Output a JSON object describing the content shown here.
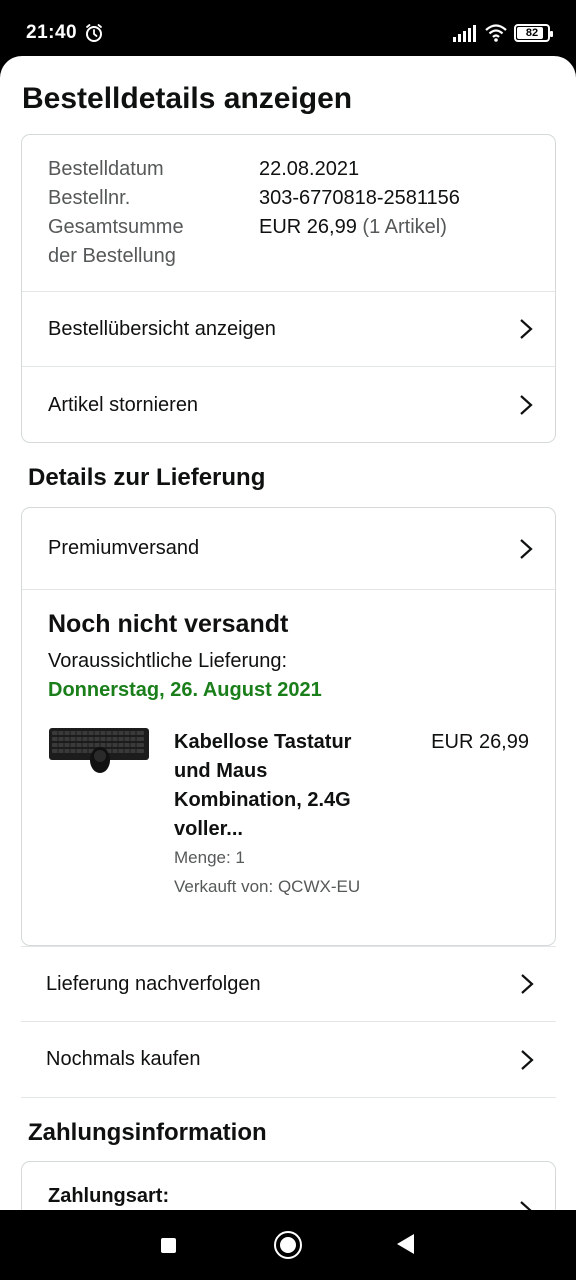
{
  "status_bar": {
    "time": "21:40",
    "battery": "82"
  },
  "page": {
    "title": "Bestelldetails anzeigen"
  },
  "order": {
    "date_label": "Bestelldatum",
    "date_value": "22.08.2021",
    "number_label": "Bestellnr.",
    "number_value": "303-6770818-2581156",
    "total_label_line1": "Gesamtsumme",
    "total_label_line2": "der Bestellung",
    "total_value": "EUR 26,99",
    "total_items": "(1 Artikel)",
    "view_summary": "Bestellübersicht anzeigen",
    "cancel_items": "Artikel stornieren"
  },
  "delivery": {
    "section_title": "Details zur Lieferung",
    "shipping_method": "Premiumversand",
    "status": "Noch nicht versandt",
    "expected_label": "Voraussichtliche Lieferung:",
    "expected_date": "Donnerstag, 26. August 2021",
    "item": {
      "title_line1": "Kabellose Tastatur",
      "title_line2": "und Maus",
      "title_line3": "Kombination, 2.4G",
      "title_line4": "voller...",
      "price": "EUR 26,99",
      "quantity": "Menge: 1",
      "seller": "Verkauft von: QCWX-EU"
    },
    "track": "Lieferung nachverfolgen",
    "buy_again": "Nochmals kaufen"
  },
  "payment": {
    "section_title": "Zahlungsinformation",
    "method_label": "Zahlungsart:"
  },
  "colors": {
    "green": "#1a7f1a",
    "border": "#d5d9d9",
    "text": "#0f1111",
    "muted": "#565959"
  }
}
